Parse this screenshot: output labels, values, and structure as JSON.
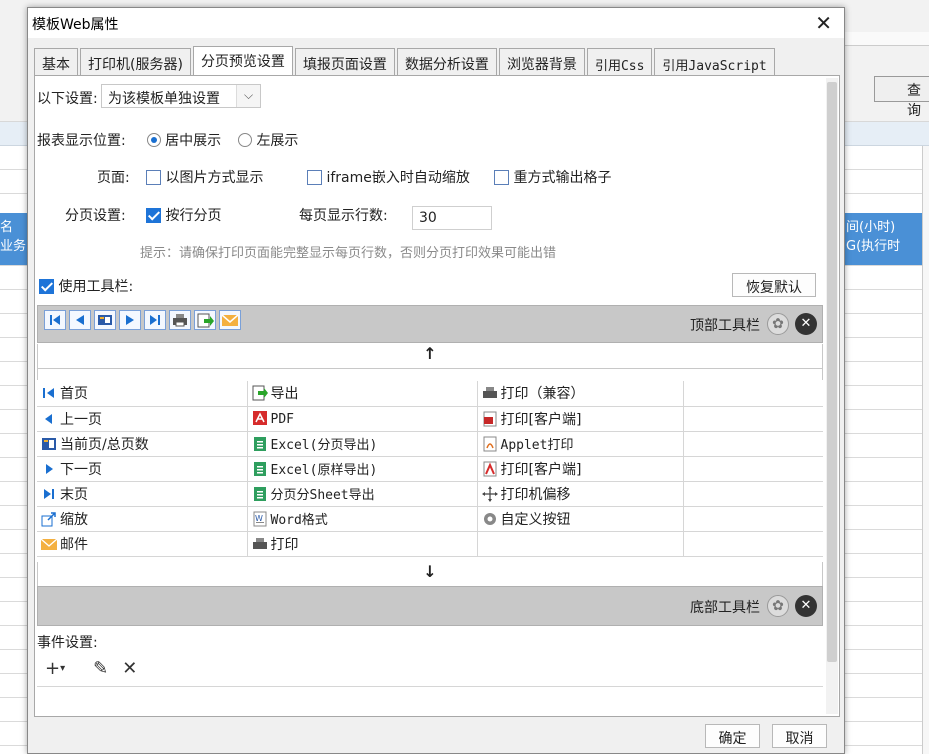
{
  "background": {
    "query_button": "查询",
    "left_cell_lines": [
      "名",
      "业务"
    ],
    "right_cell_lines": [
      "间(小时)",
      "G(执行时"
    ]
  },
  "dialog": {
    "title": "模板Web属性",
    "close": "✕",
    "tabs": [
      {
        "label": "基本",
        "active": false
      },
      {
        "label": "打印机(服务器)",
        "active": false
      },
      {
        "label": "分页预览设置",
        "active": true
      },
      {
        "label": "填报页面设置",
        "active": false
      },
      {
        "label": "数据分析设置",
        "active": false
      },
      {
        "label": "浏览器背景",
        "active": false
      },
      {
        "label": "引用Css",
        "active": false
      },
      {
        "label": "引用JavaScript",
        "active": false
      }
    ],
    "settings_scope": {
      "label": "以下设置:",
      "value": "为该模板单独设置",
      "arrow": "⌵"
    },
    "report_position": {
      "label": "报表显示位置:",
      "option_center": "居中展示",
      "option_left": "左展示",
      "selected": "center"
    },
    "page": {
      "label": "页面:",
      "as_image": {
        "label": "以图片方式显示",
        "checked": false
      },
      "iframe_scale": {
        "label": "iframe嵌入时自动缩放",
        "checked": false
      },
      "repeat_cells": {
        "label": "重方式输出格子",
        "checked": false
      }
    },
    "pagination": {
      "label": "分页设置:",
      "by_row": {
        "label": "按行分页",
        "checked": true
      },
      "rows_label": "每页显示行数:",
      "rows_value": "30",
      "hint": "提示：请确保打印页面能完整显示每页行数，否则分页打印效果可能出错"
    },
    "use_toolbar": {
      "label": "使用工具栏:",
      "checked": true
    },
    "restore_default": "恢复默认",
    "top_toolbar_label": "顶部工具栏",
    "bottom_toolbar_label": "底部工具栏",
    "up_arrow": "↑",
    "down_arrow": "↓",
    "toolbar_items": [
      [
        "首页",
        "导出",
        "打印（兼容）",
        ""
      ],
      [
        "上一页",
        "PDF",
        "打印[客户端]",
        ""
      ],
      [
        "当前页/总页数",
        "Excel(分页导出)",
        "Applet打印",
        ""
      ],
      [
        "下一页",
        "Excel(原样导出)",
        "打印[客户端]",
        ""
      ],
      [
        "末页",
        "分页分Sheet导出",
        "打印机偏移",
        ""
      ],
      [
        "缩放",
        "Word格式",
        "自定义按钮",
        ""
      ],
      [
        "邮件",
        "打印",
        "",
        ""
      ]
    ],
    "toolbar_item_icons": [
      [
        "first-page-icon",
        "export-icon",
        "print-icon",
        ""
      ],
      [
        "prev-page-icon",
        "pdf-icon",
        "flash-print-icon",
        ""
      ],
      [
        "page-count-icon",
        "excel-icon",
        "applet-print-icon",
        ""
      ],
      [
        "next-page-icon",
        "excel-icon",
        "pdf-print-icon",
        ""
      ],
      [
        "last-page-icon",
        "excel-icon",
        "move-icon",
        ""
      ],
      [
        "zoom-icon",
        "word-icon",
        "gear-icon",
        ""
      ],
      [
        "mail-icon",
        "print-icon",
        "",
        ""
      ]
    ],
    "events_label": "事件设置:",
    "ok": "确定",
    "cancel": "取消"
  }
}
